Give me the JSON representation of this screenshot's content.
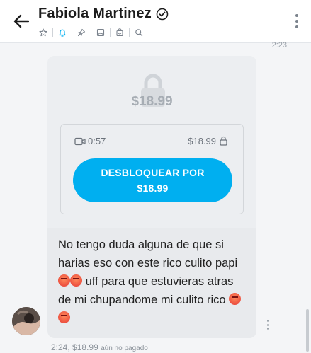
{
  "header": {
    "title": "Fabiola Martinez",
    "toolbar_icons": [
      "star-icon",
      "bell-icon",
      "pin-icon",
      "image-icon",
      "bag-icon",
      "search-icon"
    ],
    "active_icon": "bell-icon"
  },
  "previous_message": {
    "time": "2:23"
  },
  "locked_media": {
    "preview_price": "$18.99",
    "duration": "0:57",
    "price": "$18.99",
    "unlock_line1": "DESBLOQUEAR POR",
    "unlock_line2": "$18.99"
  },
  "message": {
    "text_part1": "No tengo duda alguna de que si harias eso con este rico culito papi ",
    "text_part2": " uff para que estuvieras atras de mi chupandome mi culito rico ",
    "emoji": "hot-face-emoji"
  },
  "meta": {
    "time": "2:24,",
    "price": "$18.99",
    "status": "aún no pagado"
  },
  "colors": {
    "accent": "#00aff0",
    "active_icon": "#00aff0"
  }
}
